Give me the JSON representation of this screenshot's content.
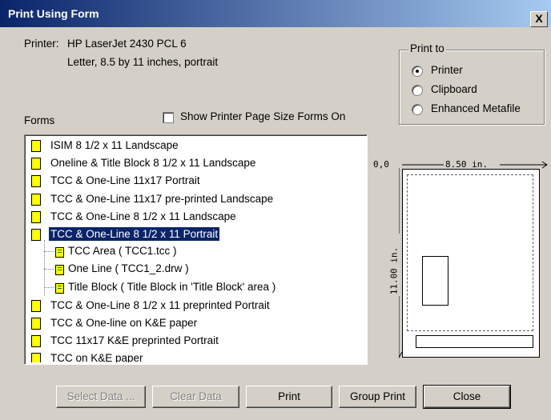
{
  "window": {
    "title": "Print Using Form",
    "close_label": "X"
  },
  "printer": {
    "label": "Printer:",
    "name": "HP LaserJet 2430 PCL 6",
    "paper": "Letter, 8.5 by 11 inches, portrait"
  },
  "print_to": {
    "legend": "Print to",
    "options": [
      {
        "label": "Printer",
        "selected": true
      },
      {
        "label": "Clipboard",
        "selected": false
      },
      {
        "label": "Enhanced Metafile",
        "selected": false
      }
    ]
  },
  "forms": {
    "label": "Forms",
    "show_printer_size_label": "Show Printer Page Size Forms On",
    "show_printer_size_checked": false,
    "items": [
      "ISIM 8 1/2 x 11 Landscape",
      "Oneline & Title Block 8 1/2 x 11 Landscape",
      "TCC & One-Line 11x17 Portrait",
      "TCC & One-Line 11x17 pre-printed Landscape",
      "TCC & One-Line 8 1/2 x 11 Landscape",
      "TCC & One-Line 8 1/2 x 11 Portrait",
      "TCC & One-Line 8 1/2 x 11 preprinted Portrait",
      "TCC & One-line on K&E paper",
      "TCC 11x17 K&E preprinted Portrait",
      "TCC on K&E paper"
    ],
    "selected_item": "TCC & One-Line 8 1/2 x 11 Portrait",
    "children": [
      "TCC Area ( TCC1.tcc )",
      "One Line ( TCC1_2.drw )",
      "Title Block ( Title Block in 'Title Block' area )"
    ]
  },
  "preview": {
    "origin": "0,0",
    "width_label": "8.50 in.",
    "height_label": "11.00 in."
  },
  "buttons": {
    "select_data": "Select Data ...",
    "clear_data": "Clear Data",
    "print": "Print",
    "group_print": "Group Print",
    "close": "Close"
  },
  "colors": {
    "titlebar": "#0a246a",
    "selection": "#0a246a",
    "dialog_bg": "#d4d0c8",
    "form_icon": "#ffff00"
  }
}
